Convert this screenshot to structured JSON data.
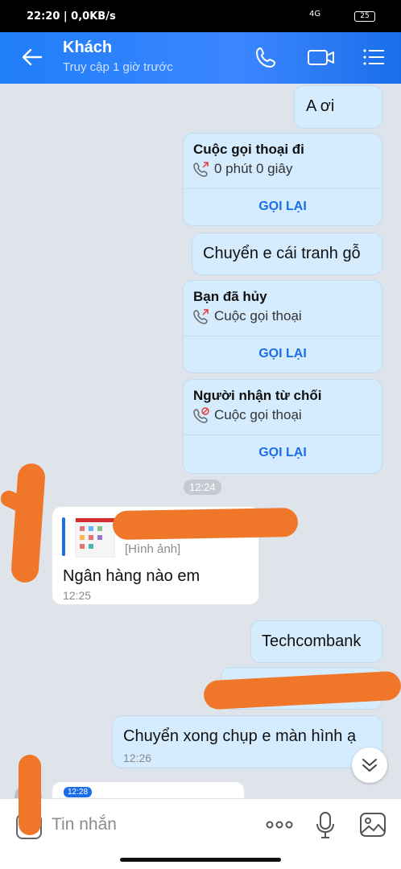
{
  "status_bar": {
    "time": "22:20 | 0,0KB/s",
    "signal": "4G",
    "battery": "25"
  },
  "header": {
    "title": "Khách",
    "subtitle": "Truy cập 1 giờ trước"
  },
  "messages": {
    "m1": "A ơi",
    "call1": {
      "title": "Cuộc gọi thoại đi",
      "detail": "0 phút 0 giây",
      "action": "GỌI LẠI"
    },
    "m2": "Chuyển e cái tranh gỗ",
    "call2": {
      "title": "Bạn đã hủy",
      "detail": "Cuộc gọi thoại",
      "action": "GỌI LẠI"
    },
    "call3": {
      "title": "Người nhận từ chối",
      "detail": "Cuộc gọi thoại",
      "action": "GỌI LẠI"
    },
    "time1": "12:24",
    "incoming1": {
      "reply_label": "[Hình ảnh]",
      "text": "Ngân hàng nào em",
      "time": "12:25"
    },
    "m3": "Techcombank",
    "m4": {
      "text": "Chuyển xong chụp e màn hình ạ",
      "time": "12:26"
    },
    "time2": "12:28"
  },
  "input": {
    "placeholder": "Tin nhắn"
  },
  "colors": {
    "header": "#1f7ef8",
    "outgoing_bubble": "#d5ecff",
    "background": "#dfe3ea",
    "accent": "#1a6ee9",
    "redaction": "#f0772a"
  }
}
